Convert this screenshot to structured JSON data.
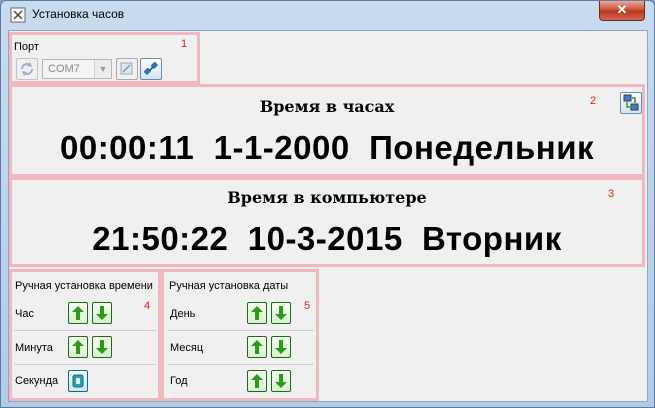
{
  "window": {
    "title": "Установка часов",
    "close_glyph": "✕"
  },
  "port": {
    "number": "1",
    "label": "Порт",
    "com_value": "COM7",
    "icons": [
      "refresh-icon",
      "checkbox-icon",
      "connect-plug-icon"
    ]
  },
  "clock": {
    "number": "2",
    "title": "Время в часах",
    "time": "00:00:11",
    "date": "1-1-2000",
    "weekday": "Понедельник"
  },
  "computer": {
    "number": "3",
    "title": "Время в компьютере",
    "time": "21:50:22",
    "date": "10-3-2015",
    "weekday": "Вторник"
  },
  "manual_time": {
    "number": "4",
    "title": "Ручная установка времени",
    "rows": [
      {
        "label": "Час"
      },
      {
        "label": "Минута"
      },
      {
        "label": "Секунда"
      }
    ]
  },
  "manual_date": {
    "number": "5",
    "title": "Ручная установка даты",
    "rows": [
      {
        "label": "День"
      },
      {
        "label": "Месяц"
      },
      {
        "label": "Год"
      }
    ]
  },
  "colors": {
    "panel_border": "#f2b8c0",
    "marker": "#e02020",
    "arrow": "#2c9a1a"
  }
}
